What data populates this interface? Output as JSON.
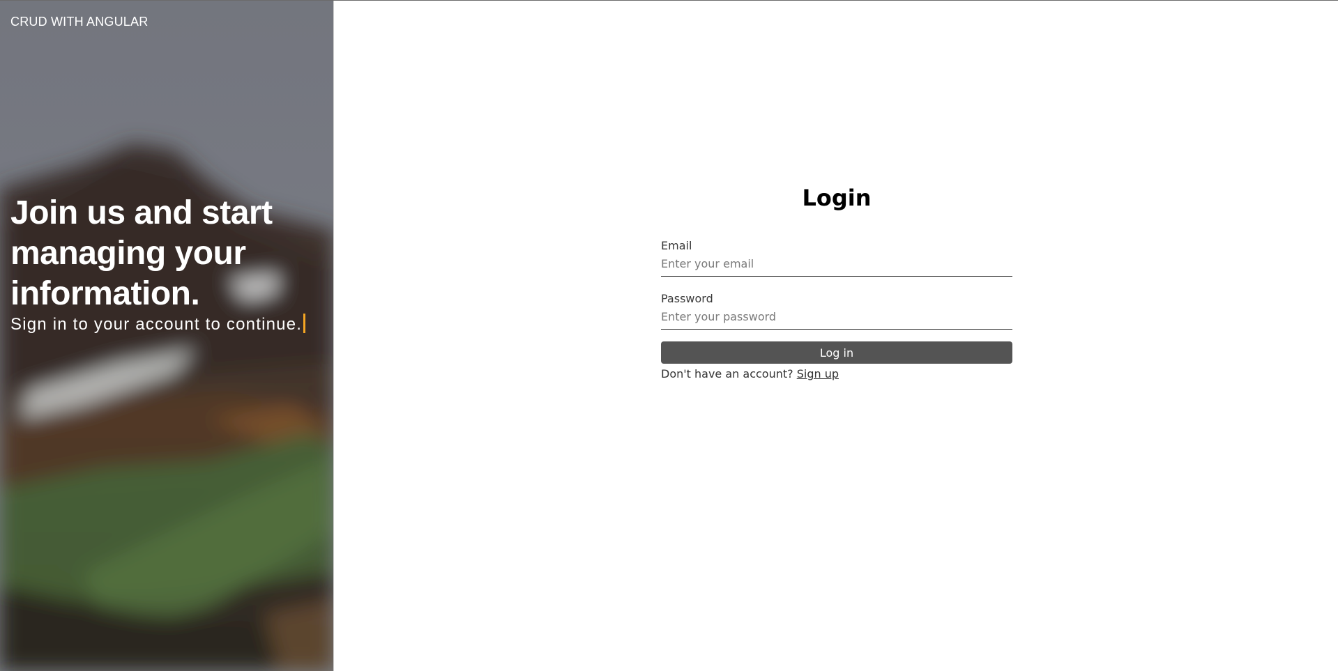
{
  "hero": {
    "brand": "CRUD WITH ANGULAR",
    "heading": "Join us and start managing your information.",
    "subheading": "Sign in to your account to continue.",
    "background_description_colors": {
      "sky": "#7a7f87",
      "mountain": "#3a302c",
      "snow": "#dfe2e3",
      "grass": "#4d6b3c",
      "earth": "#5e4631"
    }
  },
  "login": {
    "title": "Login",
    "email": {
      "label": "Email",
      "placeholder": "Enter your email",
      "value": ""
    },
    "password": {
      "label": "Password",
      "placeholder": "Enter your password",
      "value": ""
    },
    "submit_label": "Log in",
    "signup_prompt": "Don't have an account?",
    "signup_link": "Sign up"
  },
  "colors": {
    "button_bg": "#545454",
    "caret": "#f5a623"
  }
}
